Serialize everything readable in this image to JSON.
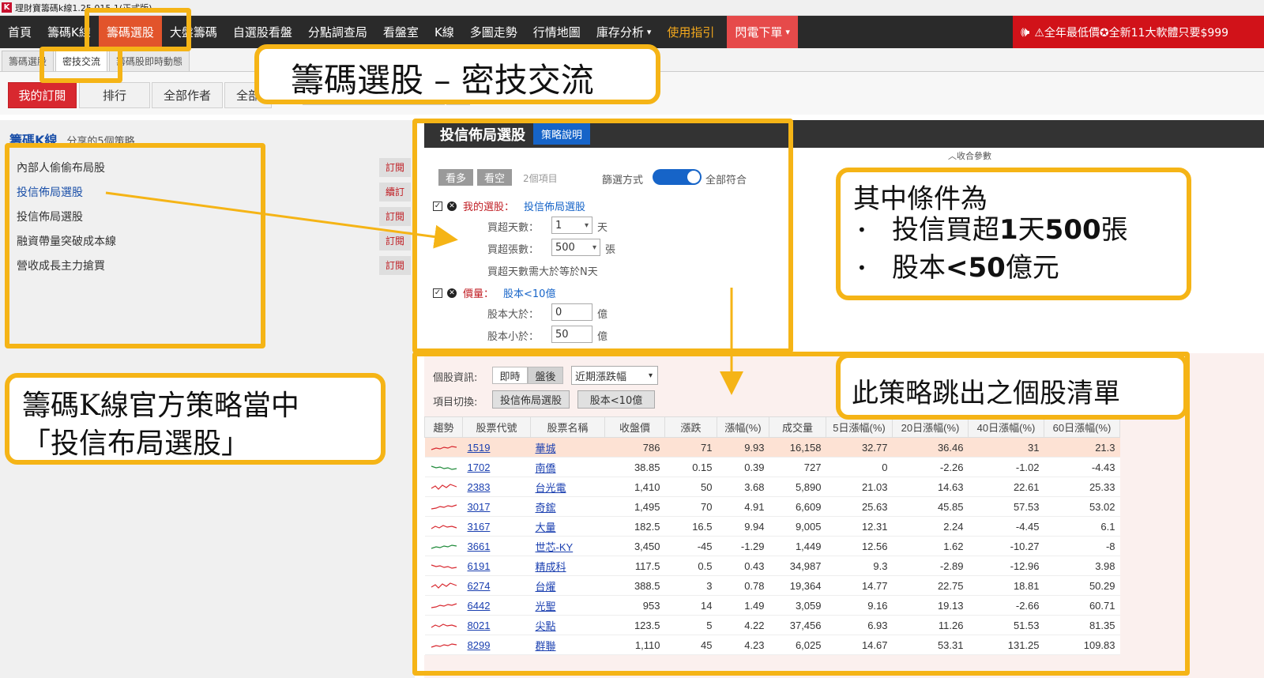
{
  "window": {
    "title": "理財寶籌碼k線1.25.015.1(正式版)",
    "icon_letter": "K"
  },
  "nav": {
    "items": [
      "首頁",
      "籌碼K線",
      "籌碼選股",
      "大盤籌碼",
      "自選股看盤",
      "分點調查局",
      "看盤室",
      "K線",
      "多圖走勢",
      "行情地圖",
      "庫存分析",
      "使用指引",
      "閃電下單"
    ],
    "active_index": 2,
    "promo": "⚠全年最低價✪全新11大軟體只要$999"
  },
  "subtabs": [
    "籌碼選股",
    "密技交流",
    "籌碼股即時動態"
  ],
  "filters": {
    "my": "我的訂閱",
    "rank": "排行",
    "authors": "全部作者",
    "all": "全部"
  },
  "left": {
    "title": "籌碼K線",
    "subtitle": "分享的5個策略",
    "strategies": [
      {
        "name": "內部人偷偷布局股",
        "button": "訂閱"
      },
      {
        "name": "投信佈局選股",
        "button": "續訂"
      },
      {
        "name": "投信佈局選股",
        "button": "訂閱"
      },
      {
        "name": "融資帶量突破成本線",
        "button": "訂閱"
      },
      {
        "name": "營收成長主力搶買",
        "button": "訂閱"
      }
    ]
  },
  "strategy": {
    "title": "投信佈局選股",
    "explain": "策略說明",
    "collapse": "收合參數",
    "long": "看多",
    "short": "看空",
    "count": "2個項目",
    "filter_mode_label": "篩選方式",
    "filter_mode_value": "全部符合",
    "cond1": {
      "key": "我的選股：",
      "value": "投信佈局選股"
    },
    "buy_days_label": "買超天數：",
    "buy_days_value": "1",
    "buy_days_unit": "天",
    "buy_lots_label": "買超張數：",
    "buy_lots_value": "500",
    "buy_lots_unit": "張",
    "buy_note": "買超天數需大於等於N天",
    "cond2": {
      "key": "價量：",
      "value": "股本<10億"
    },
    "cap_gt_label": "股本大於：",
    "cap_gt_value": "0",
    "cap_lt_label": "股本小於：",
    "cap_lt_value": "50",
    "cap_unit": "億"
  },
  "results": {
    "info_label": "個股資訊:",
    "realtime": "即時",
    "afterhours": "盤後",
    "period_select": "近期漲跌幅",
    "switch_label": "項目切換:",
    "switch_1": "投信佈局選股",
    "switch_2": "股本<10億",
    "columns": [
      "趨勢",
      "股票代號",
      "股票名稱",
      "收盤價",
      "漲跌",
      "漲幅(%)",
      "成交量",
      "5日漲幅(%)",
      "20日漲幅(%)",
      "40日漲幅(%)",
      "60日漲幅(%)"
    ],
    "rows": [
      [
        "1519",
        "華城",
        "786",
        "71",
        "9.93",
        "16,158",
        "32.77",
        "36.46",
        "31",
        "21.3"
      ],
      [
        "1702",
        "南僑",
        "38.85",
        "0.15",
        "0.39",
        "727",
        "0",
        "-2.26",
        "-1.02",
        "-4.43"
      ],
      [
        "2383",
        "台光電",
        "1,410",
        "50",
        "3.68",
        "5,890",
        "21.03",
        "14.63",
        "22.61",
        "25.33"
      ],
      [
        "3017",
        "奇鋐",
        "1,495",
        "70",
        "4.91",
        "6,609",
        "25.63",
        "45.85",
        "57.53",
        "53.02"
      ],
      [
        "3167",
        "大量",
        "182.5",
        "16.5",
        "9.94",
        "9,005",
        "12.31",
        "2.24",
        "-4.45",
        "6.1"
      ],
      [
        "3661",
        "世芯-KY",
        "3,450",
        "-45",
        "-1.29",
        "1,449",
        "12.56",
        "1.62",
        "-10.27",
        "-8"
      ],
      [
        "6191",
        "精成科",
        "117.5",
        "0.5",
        "0.43",
        "34,987",
        "9.3",
        "-2.89",
        "-12.96",
        "3.98"
      ],
      [
        "6274",
        "台燿",
        "388.5",
        "3",
        "0.78",
        "19,364",
        "14.77",
        "22.75",
        "18.81",
        "50.29"
      ],
      [
        "6442",
        "光聖",
        "953",
        "14",
        "1.49",
        "3,059",
        "9.16",
        "19.13",
        "-2.66",
        "60.71"
      ],
      [
        "8021",
        "尖點",
        "123.5",
        "5",
        "4.22",
        "37,456",
        "6.93",
        "11.26",
        "51.53",
        "81.35"
      ],
      [
        "8299",
        "群聯",
        "1,110",
        "45",
        "4.23",
        "6,025",
        "14.67",
        "53.31",
        "131.25",
        "109.83"
      ]
    ],
    "trend_colors": [
      "red",
      "green",
      "red",
      "red",
      "red",
      "green",
      "red",
      "red",
      "red",
      "red",
      "red"
    ]
  },
  "annotations": {
    "top": "籌碼選股 – 密技交流",
    "cond_title": "其中條件為",
    "cond_b1_a": "投信買超",
    "cond_b1_b": "1",
    "cond_b1_c": "天",
    "cond_b1_d": "500",
    "cond_b1_e": "張",
    "cond_b2_a": "股本",
    "cond_b2_b": "<50",
    "cond_b2_c": "億元",
    "list": "此策略跳出之個股清單",
    "left_1": "籌碼K線官方策略當中",
    "left_2": "「投信布局選股」"
  },
  "colors": {
    "accent": "#f5b416",
    "nav_active": "#e2542b",
    "up": "#d8282f",
    "down": "#1f8a3a",
    "link": "#1a3fb0"
  }
}
